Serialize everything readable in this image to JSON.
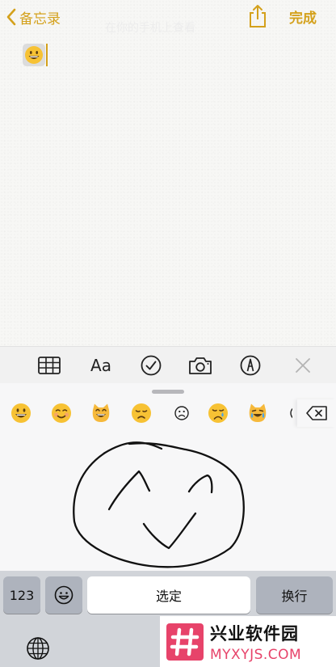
{
  "nav": {
    "back_label": "备忘录",
    "done_label": "完成",
    "share_icon": "share-icon",
    "back_icon": "chevron-left-icon",
    "accent_color": "#d4a11c"
  },
  "note": {
    "emoji_icon": "grinning-face-emoji",
    "background_title": "在你的手机上查看"
  },
  "toolbar": {
    "table_icon": "table-icon",
    "format_label": "Aa",
    "checklist_icon": "checklist-icon",
    "camera_icon": "camera-icon",
    "markup_icon": "markup-pen-icon",
    "close_icon": "close-icon"
  },
  "keyboard": {
    "emoji_suggestions": [
      "grinning-face",
      "smiling-face",
      "grinning-cat",
      "disappointed-face",
      "frowning-face",
      "crying-face",
      "crying-cat",
      "emoji-partial"
    ],
    "delete_icon": "delete-backspace-icon",
    "handwriting_canvas": "handwriting-smiley-sketch",
    "keys": {
      "numbers_label": "123",
      "emoji_icon": "emoji-keyboard-icon",
      "select_label": "选定",
      "return_label": "换行",
      "globe_icon": "globe-icon"
    }
  },
  "watermark": {
    "name": "兴业软件园",
    "domain": "MYXYJS.COM",
    "logo_color": "#e7436a"
  }
}
